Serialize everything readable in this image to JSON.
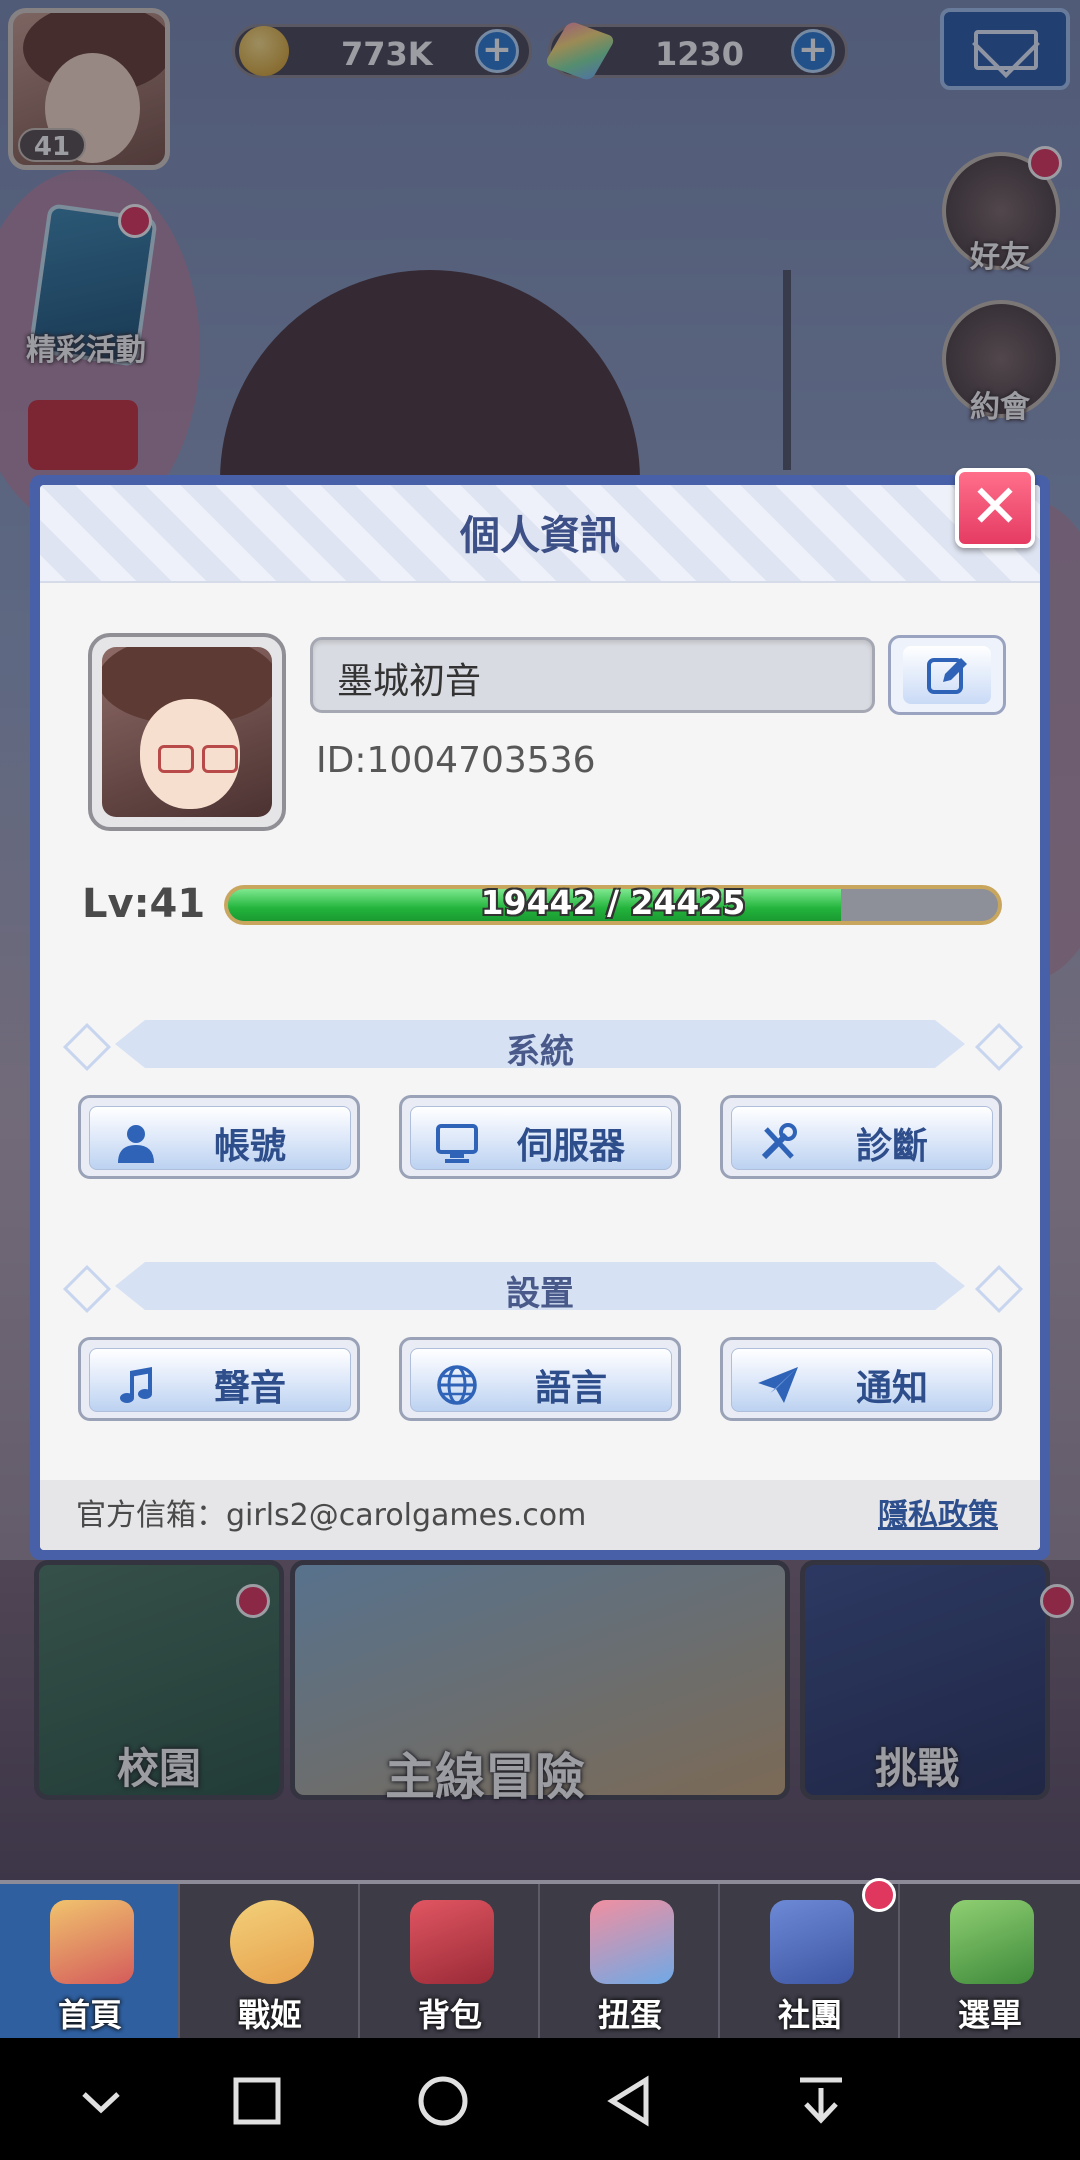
{
  "hud": {
    "player_level": "41",
    "gold": "773K",
    "gems": "1230"
  },
  "side": {
    "events_label": "精彩活動",
    "friends_label": "好友",
    "date_label": "約會"
  },
  "modal": {
    "title": "個人資訊",
    "close_glyph": "✕",
    "player_name": "墨城初音",
    "player_id": "ID:1004703536",
    "level_label": "Lv:41",
    "xp_text": "19442 / 24425",
    "xp_progress": 0.796,
    "system_section": "系統",
    "system_buttons": [
      {
        "label": "帳號",
        "icon": "user-icon"
      },
      {
        "label": "伺服器",
        "icon": "monitor-icon"
      },
      {
        "label": "診斷",
        "icon": "tools-icon"
      }
    ],
    "settings_section": "設置",
    "settings_buttons": [
      {
        "label": "聲音",
        "icon": "music-note-icon"
      },
      {
        "label": "語言",
        "icon": "globe-icon"
      },
      {
        "label": "通知",
        "icon": "paper-plane-icon"
      }
    ],
    "footer_email": "官方信箱：girls2@carolgames.com",
    "privacy_link": "隱私政策"
  },
  "cards": {
    "campus": "校園",
    "main_adventure": "主線冒險",
    "challenge": "挑戰"
  },
  "nav": [
    {
      "label": "首頁"
    },
    {
      "label": "戰姬"
    },
    {
      "label": "背包"
    },
    {
      "label": "扭蛋"
    },
    {
      "label": "社團"
    },
    {
      "label": "選單"
    }
  ],
  "colors": {
    "accent_blue": "#2d4d8b",
    "xp_green": "#23b43c",
    "close_red": "#e53b63"
  }
}
